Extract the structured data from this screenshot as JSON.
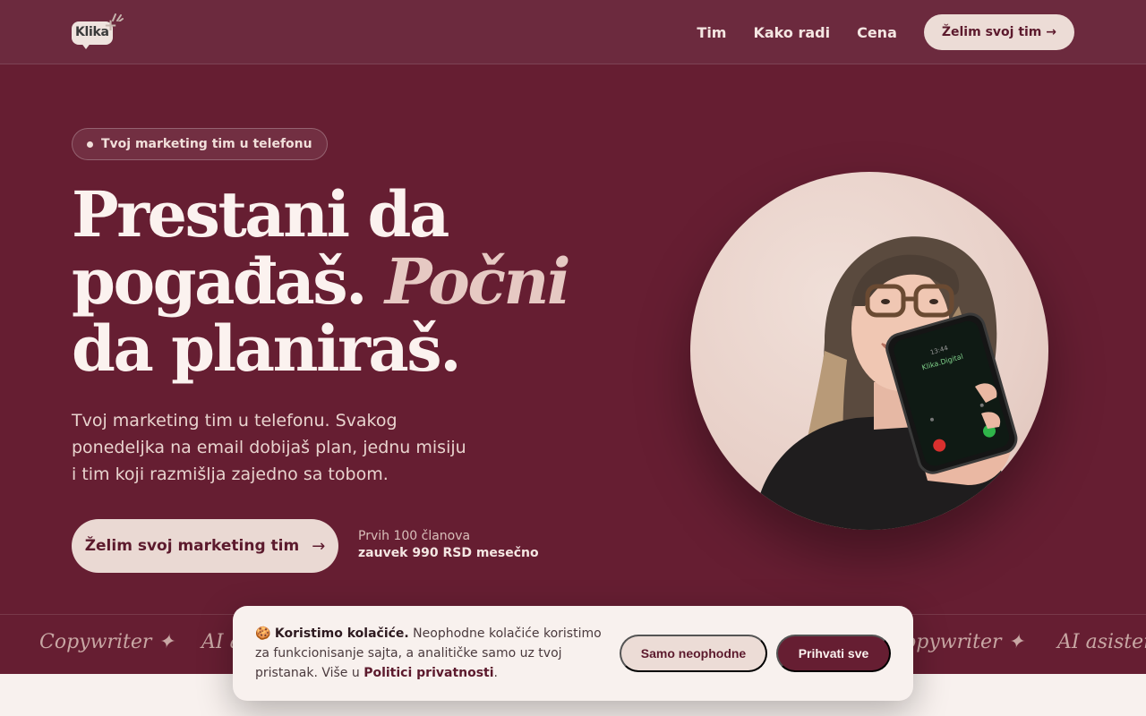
{
  "header": {
    "logo_text": "Klika",
    "nav": [
      "Tim",
      "Kako radi",
      "Cena"
    ],
    "cta_label": "Želim svoj tim →"
  },
  "hero": {
    "badge": "Tvoj marketing tim u telefonu",
    "headline_line1": "Prestani da",
    "headline_line2_plain": "pogađaš.",
    "headline_line2_italic": "Počni",
    "headline_line3": "da planiraš.",
    "subtext": "Tvoj marketing tim u telefonu. Svakog ponedeljka na email dobijaš plan, jednu misiju i tim koji razmišlja zajedno sa tobom.",
    "cta_label": "Želim svoj marketing tim",
    "cta_arrow": "→",
    "offer_line1": "Prvih 100 članova",
    "offer_line2": "zauvek 990 RSD mesečno"
  },
  "portrait": {
    "phone_app_label": "Klika.Digital",
    "phone_time": "13:44"
  },
  "marquee": {
    "items": [
      "Copywriter ✦",
      "AI a",
      "opywriter ✦",
      "AI asistent"
    ]
  },
  "cookie": {
    "emoji": "🍪",
    "title": "Koristimo kolačiće.",
    "body": " Neophodne kolačiće koristimo za funkcionisanje sajta, a analitičke samo uz tvoj pristanak. Više u ",
    "link": "Politici privatnosti",
    "end": ".",
    "btn_necessary": "Samo neophodne",
    "btn_accept": "Prihvati sve"
  },
  "colors": {
    "background": "#661e32",
    "header": "#6c2a3e",
    "cream": "#ead9d3",
    "accent_text": "#5c1a2d"
  }
}
